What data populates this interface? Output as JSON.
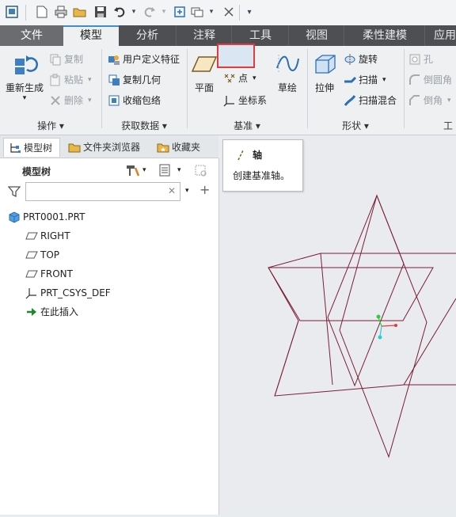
{
  "menu_tabs": [
    "文件",
    "模型",
    "分析",
    "注释",
    "工具",
    "视图",
    "柔性建模",
    "应用"
  ],
  "ribbon": {
    "regenerate_label": "重新生成",
    "copy_label": "复制",
    "paste_label": "粘贴",
    "delete_label": "删除",
    "user_defined_feature_label": "用户定义特征",
    "copy_geometry_label": "复制几何",
    "shrinkwrap_label": "收缩包络",
    "plane_label": "平面",
    "axis_label": "轴",
    "point_label": "点",
    "coordinate_system_label": "坐标系",
    "sketch_label": "草绘",
    "extrude_label": "拉伸",
    "revolve_label": "旋转",
    "sweep_label": "扫描",
    "swept_blend_label": "扫描混合",
    "hole_label": "孔",
    "round_label": "倒圆角",
    "chamfer_label": "倒角",
    "groups": [
      "操作",
      "获取数据",
      "基准",
      "形状",
      "工"
    ]
  },
  "tooltip": {
    "title": "轴",
    "description": "创建基准轴。"
  },
  "pane_tabs": [
    "模型树",
    "文件夹浏览器",
    "收藏夹"
  ],
  "model_tree": {
    "title": "模型树",
    "search_placeholder": "",
    "items": [
      "PRT0001.PRT",
      "RIGHT",
      "TOP",
      "FRONT",
      "PRT_CSYS_DEF",
      "在此插入"
    ]
  },
  "colors": {
    "ribbon_tab_bar": "#4d4f52",
    "highlight_border": "#e23b3b",
    "datum_plane_edges": "#7a1f33",
    "insert_arrow": "#1a8a2a"
  }
}
